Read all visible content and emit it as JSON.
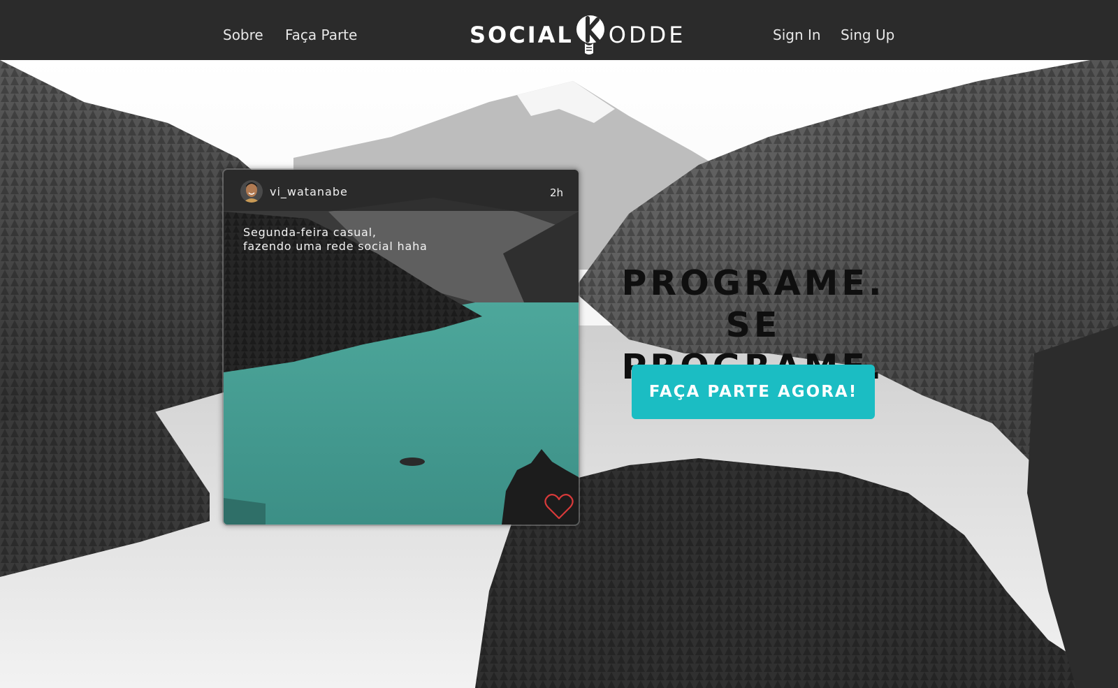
{
  "nav": {
    "left_links": [
      {
        "label": "Sobre"
      },
      {
        "label": "Faça Parte"
      }
    ],
    "logo": {
      "part1": "SOCIAL",
      "part2": "ODDE"
    },
    "right_links": [
      {
        "label": "Sign In"
      },
      {
        "label": "Sing Up"
      }
    ]
  },
  "post": {
    "username": "vi_watanabe",
    "time": "2h",
    "caption_lines": [
      "Segunda-feira casual,",
      "fazendo uma rede social haha"
    ],
    "like_icon": "heart-icon",
    "like_color": "#d93a3a"
  },
  "hero": {
    "headline_line1": "PROGRAME.",
    "headline_line2": "SE PROGRAME.",
    "cta_label": "FAÇA PARTE AGORA!",
    "cta_color": "#1bbdc3"
  },
  "colors": {
    "nav_bg": "#2b2b2b",
    "lake_teal": "#3f9b91"
  }
}
